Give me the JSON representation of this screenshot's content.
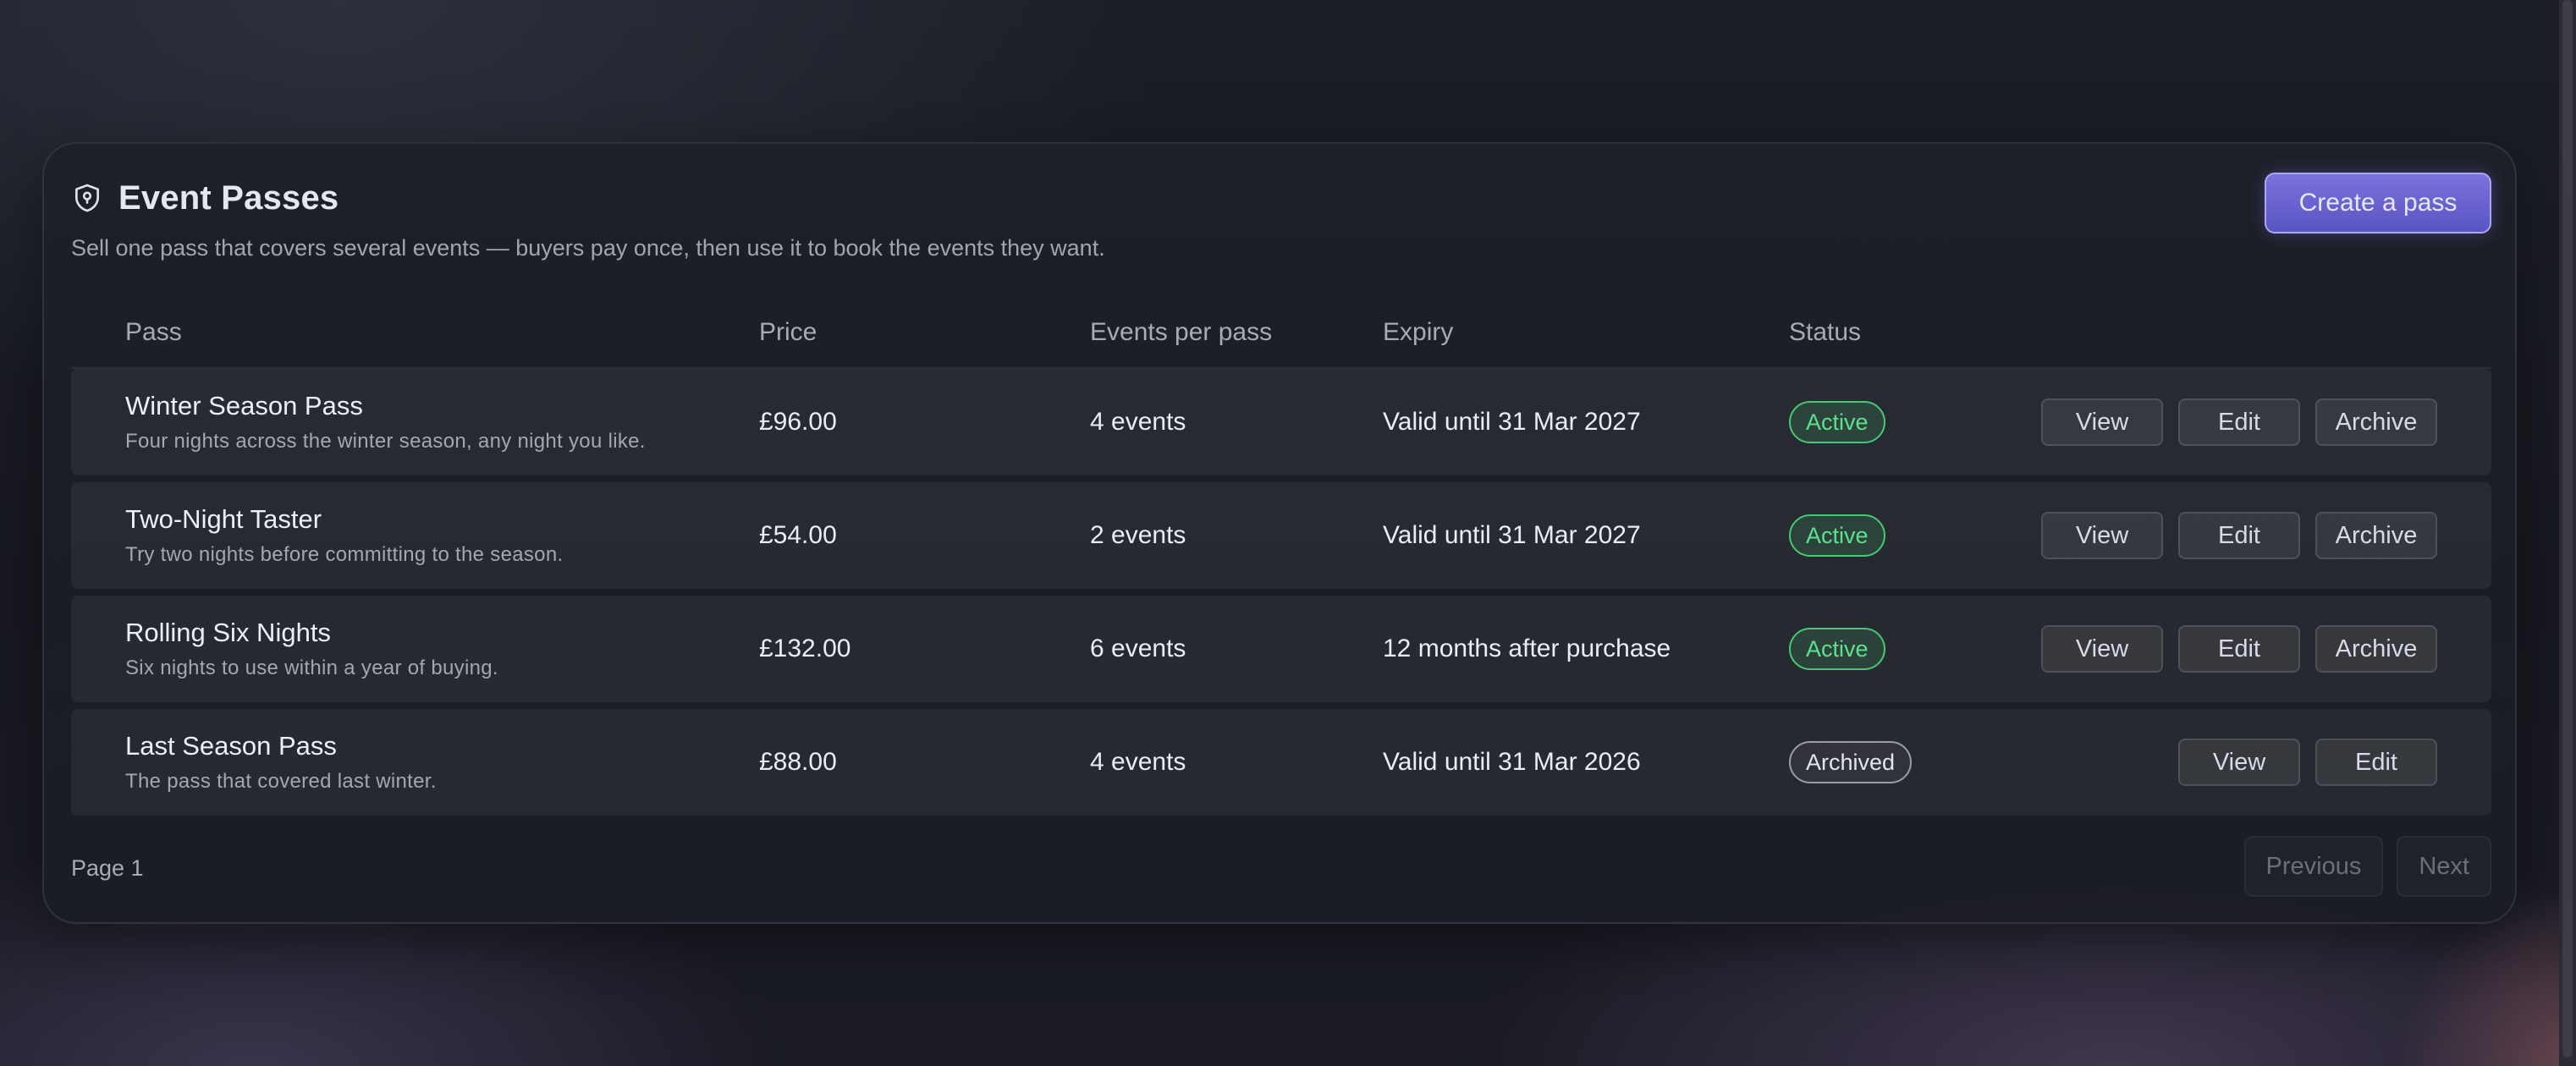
{
  "header": {
    "title": "Event Passes",
    "subtitle": "Sell one pass that covers several events — buyers pay once, then use it to book the events they want.",
    "create_label": "Create a pass",
    "icon": "shield-pin-icon"
  },
  "table": {
    "columns": [
      "Pass",
      "Price",
      "Events per pass",
      "Expiry",
      "Status"
    ],
    "rows": [
      {
        "name": "Winter Season Pass",
        "description": "Four nights across the winter season, any night you like.",
        "price": "£96.00",
        "events": "4 events",
        "expiry": "Valid until 31 Mar 2027",
        "status": "Active",
        "actions": [
          "View",
          "Edit",
          "Archive"
        ]
      },
      {
        "name": "Two-Night Taster",
        "description": "Try two nights before committing to the season.",
        "price": "£54.00",
        "events": "2 events",
        "expiry": "Valid until 31 Mar 2027",
        "status": "Active",
        "actions": [
          "View",
          "Edit",
          "Archive"
        ]
      },
      {
        "name": "Rolling Six Nights",
        "description": "Six nights to use within a year of buying.",
        "price": "£132.00",
        "events": "6 events",
        "expiry": "12 months after purchase",
        "status": "Active",
        "actions": [
          "View",
          "Edit",
          "Archive"
        ]
      },
      {
        "name": "Last Season Pass",
        "description": "The pass that covered last winter.",
        "price": "£88.00",
        "events": "4 events",
        "expiry": "Valid until 31 Mar 2026",
        "status": "Archived",
        "actions": [
          "View",
          "Edit"
        ]
      }
    ]
  },
  "footer": {
    "page_label": "Page 1",
    "previous_label": "Previous",
    "next_label": "Next"
  },
  "colors": {
    "accent": "#6a63d2",
    "active": "#5fe08d",
    "background": "#17181f"
  }
}
